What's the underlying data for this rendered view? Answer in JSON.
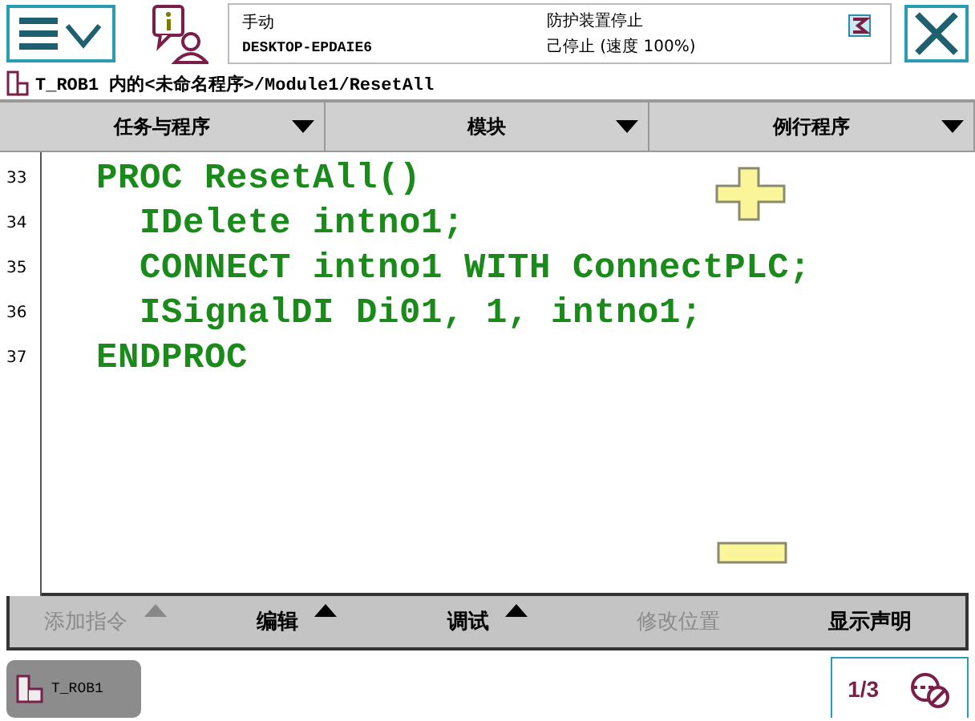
{
  "status": {
    "mode": "手动",
    "system": "DESKTOP-EPDAIE6",
    "guard": "防护装置停止",
    "state": "己停止 (速度 100%)"
  },
  "path": "T_ROB1 内的<未命名程序>/Module1/ResetAll",
  "tabs": [
    {
      "label": "任务与程序"
    },
    {
      "label": "模块"
    },
    {
      "label": "例行程序"
    }
  ],
  "code_lines": [
    {
      "number": "33",
      "text": "  PROC ResetAll()"
    },
    {
      "number": "34",
      "text": "    IDelete intno1;"
    },
    {
      "number": "35",
      "text": "    CONNECT intno1 WITH ConnectPLC;"
    },
    {
      "number": "36",
      "text": "    ISignalDI Di01, 1, intno1;"
    },
    {
      "number": "37",
      "text": "  ENDPROC"
    }
  ],
  "commands": [
    {
      "label": "添加指令",
      "disabled": true,
      "has_menu": true
    },
    {
      "label": "编辑",
      "disabled": false,
      "has_menu": true
    },
    {
      "label": "调试",
      "disabled": false,
      "has_menu": true
    },
    {
      "label": "修改位置",
      "disabled": true,
      "has_menu": false
    },
    {
      "label": "显示声明",
      "disabled": false,
      "has_menu": false
    }
  ],
  "taskbar": {
    "task": "T_ROB1",
    "quickset": "1/3"
  }
}
